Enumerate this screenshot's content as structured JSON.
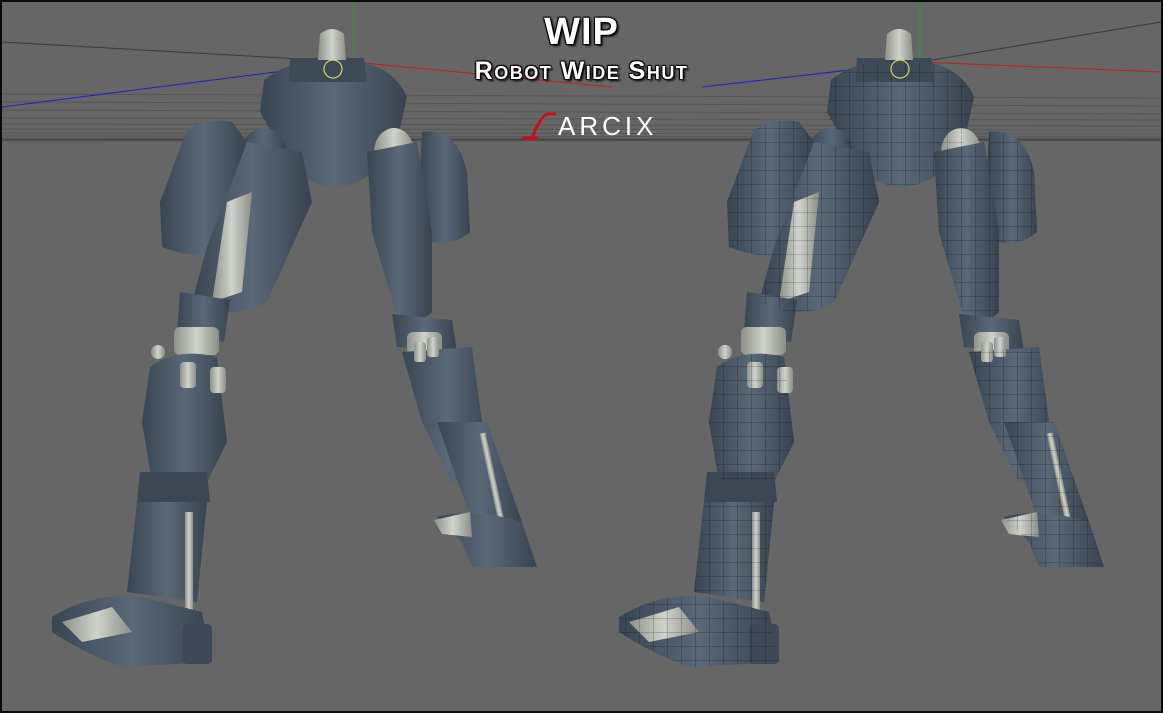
{
  "title": "WIP",
  "subtitle": "Robot Wide Shut",
  "logo_text": "ARCIX",
  "colors": {
    "background": "#666666",
    "floor_grid": "#555555",
    "robot_body": "#4b5868",
    "robot_shadow": "#343d49",
    "joint_light": "#b8bcb3",
    "axis_x": "#c02020",
    "axis_y": "#20a040",
    "axis_z": "#2020c0",
    "logo_accent": "#c8101a"
  },
  "views": [
    {
      "name": "shaded-robot",
      "wireframe": false
    },
    {
      "name": "wireframe-robot",
      "wireframe": true
    }
  ]
}
